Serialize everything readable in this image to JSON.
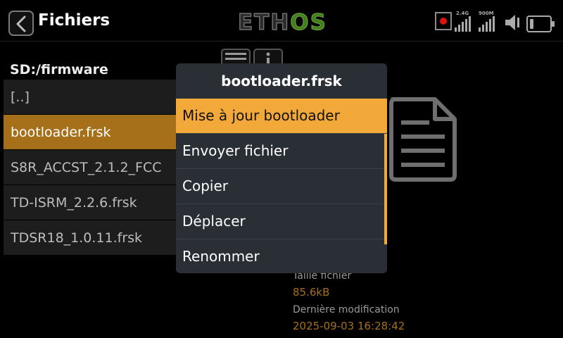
{
  "header": {
    "title": "Fichiers",
    "logo_left": "ETH",
    "logo_right": "OS",
    "signal_24g_label": "2.4G",
    "signal_900m_label": "900M"
  },
  "browser": {
    "path": "SD:/firmware",
    "files": [
      {
        "name": "[..]"
      },
      {
        "name": "bootloader.frsk"
      },
      {
        "name": "S8R_ACCST_2.1.2_FCC"
      },
      {
        "name": "TD-ISRM_2.2.6.frsk"
      },
      {
        "name": "TDSR18_1.0.11.frsk"
      }
    ],
    "selected_index": 1
  },
  "details": {
    "size_label": "Taille fichier",
    "size_value": "85.6kB",
    "modified_label": "Dernière modification",
    "modified_value": "2025-09-03 16:28:42"
  },
  "dialog": {
    "title": "bootloader.frsk",
    "items": [
      {
        "label": "Mise à jour bootloader"
      },
      {
        "label": "Envoyer fichier"
      },
      {
        "label": "Copier"
      },
      {
        "label": "Déplacer"
      },
      {
        "label": "Renommer"
      }
    ],
    "highlighted_index": 0
  },
  "colors": {
    "accent": "#f3a93a",
    "selected_row": "#a6701a",
    "dialog_bg": "#2a2f36",
    "record_dot": "#dd1111"
  },
  "icons": [
    "back-arrow-icon",
    "record-icon",
    "signal-2.4g-icon",
    "signal-900m-icon",
    "speaker-icon",
    "battery-icon",
    "menu-icon",
    "more-options-icon",
    "file-document-icon"
  ]
}
